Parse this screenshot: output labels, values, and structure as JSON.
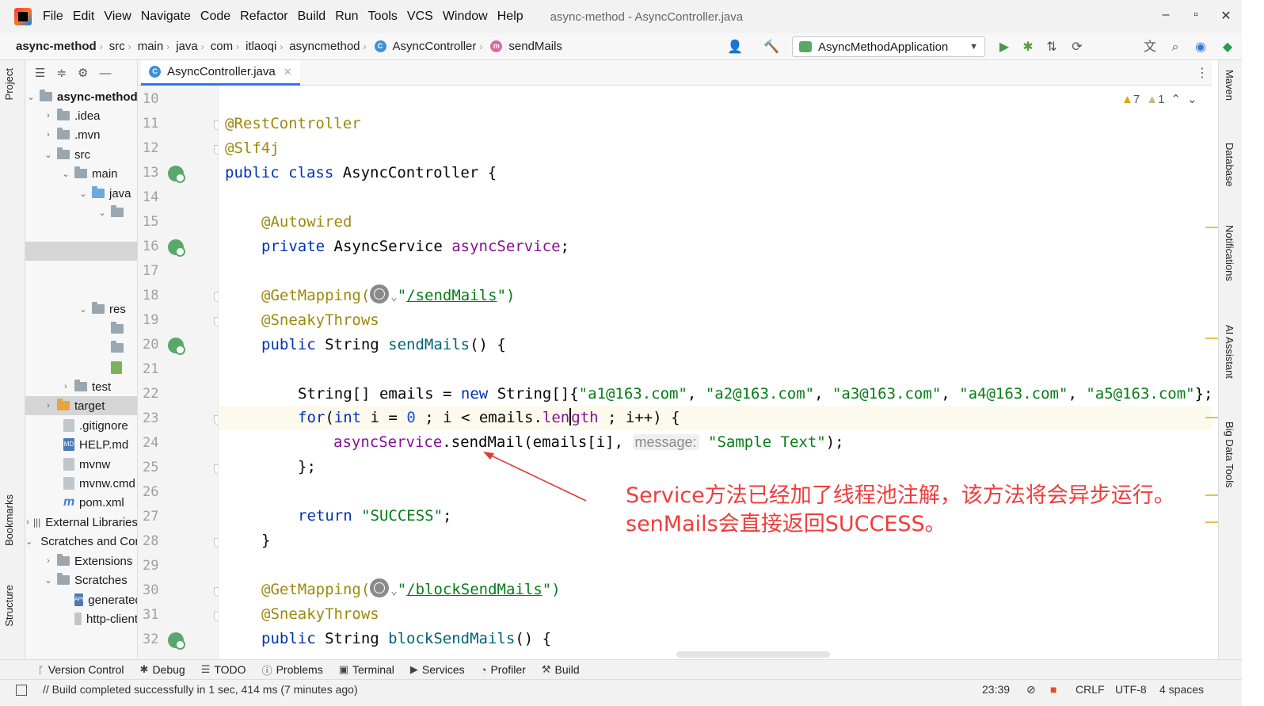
{
  "menu": [
    "File",
    "Edit",
    "View",
    "Navigate",
    "Code",
    "Refactor",
    "Build",
    "Run",
    "Tools",
    "VCS",
    "Window",
    "Help"
  ],
  "window_title": "async-method - AsyncController.java",
  "window_controls": {
    "minimize": "–",
    "maximize": "▫",
    "close": "✕"
  },
  "breadcrumbs": [
    "async-method",
    "src",
    "main",
    "java",
    "com",
    "itlaoqi",
    "asyncmethod",
    "AsyncController",
    "sendMails"
  ],
  "run_config": "AsyncMethodApplication",
  "left_tabs": {
    "project": "Project",
    "bookmarks": "Bookmarks",
    "structure": "Structure"
  },
  "right_tabs": {
    "maven": "Maven",
    "database": "Database",
    "notifications": "Notifications",
    "ai": "AI Assistant",
    "bigdata": "Big Data Tools"
  },
  "tree": {
    "root": "async-method",
    "idea": ".idea",
    "mvn": ".mvn",
    "src": "src",
    "main": "main",
    "java": "java",
    "res": "res",
    "test": "test",
    "target": "target",
    "gitignore": ".gitignore",
    "help": "HELP.md",
    "mvnw": "mvnw",
    "mvnwcmd": "mvnw.cmd",
    "pom": "pom.xml",
    "external": "External Libraries",
    "scratches": "Scratches and Consoles",
    "extensions": "Extensions",
    "scratches2": "Scratches",
    "generated": "generated-requests",
    "http": "http-client"
  },
  "tab": {
    "name": "AsyncController.java"
  },
  "line_numbers": [
    "10",
    "11",
    "12",
    "13",
    "14",
    "15",
    "16",
    "17",
    "18",
    "19",
    "20",
    "21",
    "22",
    "23",
    "24",
    "25",
    "26",
    "27",
    "28",
    "29",
    "30",
    "31",
    "32"
  ],
  "code": {
    "l11": "@RestController",
    "l12": "@Slf4j",
    "l13_kw": "public class",
    "l13_name": " AsyncController {",
    "l15": "@Autowired",
    "l16_kw": "private",
    "l16_type": " AsyncService ",
    "l16_field": "asyncService",
    "l16_end": ";",
    "l18_anno": "@GetMapping(",
    "l18_q1": "\"",
    "l18_path": "/sendMails",
    "l18_end": "\")",
    "l19": "@SneakyThrows",
    "l20_kw": "public",
    "l20_rest": " String ",
    "l20_name": "sendMails",
    "l20_end": "() {",
    "l22_a": "String[] emails",
    "l22_b": " = ",
    "l22_new": "new",
    "l22_c": " String[]{",
    "l22_s1": "\"a1@163.com\"",
    "l22_s2": "\"a2@163.com\"",
    "l22_s3": "\"a3@163.com\"",
    "l22_s4": "\"a4@163.com\"",
    "l22_s5": "\"a5@163.com\"",
    "l22_end": "};",
    "l23_for": "for",
    "l23_a": "(",
    "l23_int": "int",
    "l23_b": " i = ",
    "l23_zero": "0",
    "l23_c": " ; i < emails.",
    "l23_len1": "len",
    "l23_len2": "gth",
    "l23_d": " ; i++) {",
    "l24_field": "asyncService",
    "l24_a": ".sendMail(emails[i], ",
    "l24_hint": "message:",
    "l24_str": "\"Sample Text\"",
    "l24_end": ");",
    "l25": "};",
    "l27_ret": "return",
    "l27_str": " \"SUCCESS\"",
    "l27_end": ";",
    "l28": "}",
    "l30_anno": "@GetMapping(",
    "l30_q1": "\"",
    "l30_path": "/blockSendMails",
    "l30_end": "\")",
    "l31": "@SneakyThrows",
    "l32_kw": "public",
    "l32_rest": " String ",
    "l32_name": "blockSendMails",
    "l32_end": "() {"
  },
  "inspections": {
    "warnings": "7",
    "weak_warnings": "1"
  },
  "annotation": {
    "line1": "Service方法已经加了线程池注解，该方法将会异步运行。",
    "line2": "senMails会直接返回SUCCESS。",
    "color": "#f03c3c"
  },
  "bottom_tools": [
    "Version Control",
    "Debug",
    "TODO",
    "Problems",
    "Terminal",
    "Services",
    "Profiler",
    "Build"
  ],
  "status": {
    "message": "// Build completed successfully in 1 sec, 414 ms (7 minutes ago)",
    "position": "23:39",
    "line_sep": "CRLF",
    "encoding": "UTF-8",
    "indent": "4 spaces"
  },
  "colors": {
    "accent": "#3574f0",
    "annotation": "#9e880d",
    "keyword": "#0033b3",
    "string": "#067d17",
    "field": "#871094",
    "arrow": "#e53935"
  }
}
